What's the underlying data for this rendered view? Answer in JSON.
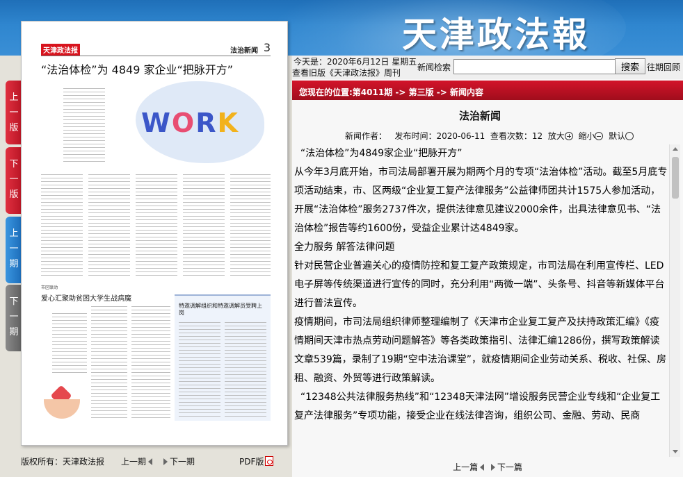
{
  "banner": {
    "masthead": "天津政法報"
  },
  "side_tabs": {
    "prev_page": [
      "上",
      "一",
      "版"
    ],
    "next_page": [
      "下",
      "一",
      "版"
    ],
    "prev_issue": [
      "上",
      "一",
      "期"
    ],
    "next_issue": [
      "下",
      "一",
      "期"
    ]
  },
  "paper": {
    "logo": "天津政法报",
    "section": "法治新闻",
    "page_no": "3",
    "headline": "“法治体检”为 4849 家企业“把脉开方”",
    "art_word": [
      "W",
      "O",
      "R",
      "K"
    ],
    "story2_kicker": "市区联动",
    "story2_title": "爱心汇聚助贫困大学生战病魔",
    "story3_title": "特邀调解组织和特邀调解员受聘上岗"
  },
  "left_footer": {
    "copyright": "版权所有：天津政法报",
    "prev": "上一期",
    "next": "下一期",
    "pdf": "PDF版"
  },
  "infobar": {
    "today": "今天是：2020年6月12日 星期五",
    "old_issues": "查看旧版《天津政法报》周刊",
    "search_label": "新闻检索",
    "search_value": "",
    "search_button": "搜索",
    "past_link": "往期回顾"
  },
  "location": "您现在的位置:第4011期 -> 第三版 -> 新闻内容",
  "article": {
    "section": "法治新闻",
    "meta": {
      "author": "新闻作者：",
      "date": "发布时间：2020-06-11",
      "views": "查看次数：12",
      "zoom_in": "放大",
      "zoom_out": "缩小",
      "default": "默认"
    },
    "paragraphs": [
      "  “法治体检”为4849家企业“把脉开方”",
      "从今年3月底开始，市司法局部署开展为期两个月的专项“法治体检”活动。截至5月底专项活动结束，市、区两级“企业复工复产法律服务”公益律师团共计1575人参加活动，开展“法治体检”服务2737件次，提供法律意见建议2000余件，出具法律意见书、“法治体检”报告等约1600份，受益企业累计达4849家。",
      "全力服务 解答法律问题",
      "针对民营企业普遍关心的疫情防控和复工复产政策规定，市司法局在利用宣传栏、LED电子屏等传统渠道进行宣传的同时，充分利用“两微一端”、头条号、抖音等新媒体平台进行普法宣传。",
      "疫情期间，市司法局组织律师整理编制了《天津市企业复工复产及扶持政策汇编》《疫情期间天津市热点劳动问题解答》等各类政策指引、法律汇编1286份，撰写政策解读文章539篇，录制了19期“空中法治课堂”，就疫情期间企业劳动关系、税收、社保、房租、融资、外贸等进行政策解读。",
      "  “12348公共法律服务热线”和“12348天津法网”增设服务民营企业专线和“企业复工复产法律服务”专项功能，接受企业在线法律咨询，组织公司、金融、劳动、民商"
    ],
    "nav": {
      "prev": "上一篇",
      "next": "下一篇"
    }
  }
}
